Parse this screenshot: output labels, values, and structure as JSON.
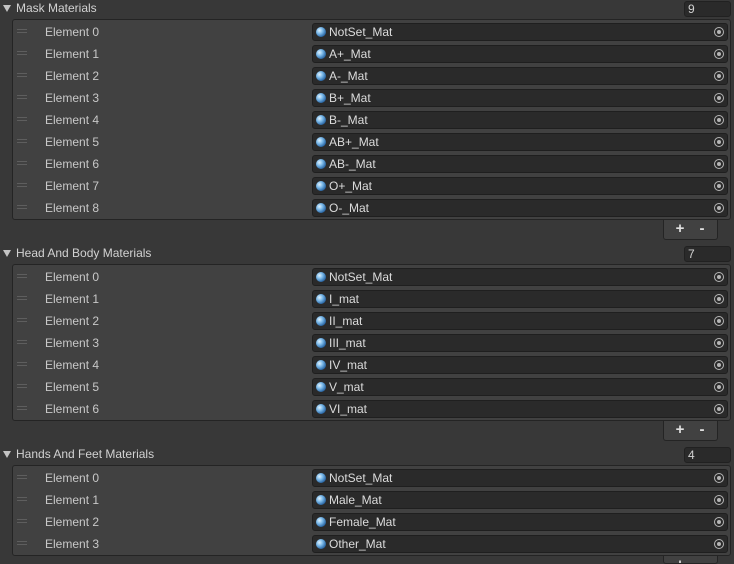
{
  "sections": [
    {
      "title": "Mask Materials",
      "size": "9",
      "items": [
        {
          "label": "Element 0",
          "value": "NotSet_Mat"
        },
        {
          "label": "Element 1",
          "value": "A+_Mat"
        },
        {
          "label": "Element 2",
          "value": "A-_Mat"
        },
        {
          "label": "Element 3",
          "value": "B+_Mat"
        },
        {
          "label": "Element 4",
          "value": "B-_Mat"
        },
        {
          "label": "Element 5",
          "value": "AB+_Mat"
        },
        {
          "label": "Element 6",
          "value": "AB-_Mat"
        },
        {
          "label": "Element 7",
          "value": "O+_Mat"
        },
        {
          "label": "Element 8",
          "value": "O-_Mat"
        }
      ]
    },
    {
      "title": "Head And Body Materials",
      "size": "7",
      "items": [
        {
          "label": "Element 0",
          "value": "NotSet_Mat"
        },
        {
          "label": "Element 1",
          "value": "I_mat"
        },
        {
          "label": "Element 2",
          "value": "II_mat"
        },
        {
          "label": "Element 3",
          "value": "III_mat"
        },
        {
          "label": "Element 4",
          "value": "IV_mat"
        },
        {
          "label": "Element 5",
          "value": "V_mat"
        },
        {
          "label": "Element 6",
          "value": "VI_mat"
        }
      ]
    },
    {
      "title": "Hands And Feet Materials",
      "size": "4",
      "items": [
        {
          "label": "Element 0",
          "value": "NotSet_Mat"
        },
        {
          "label": "Element 1",
          "value": "Male_Mat"
        },
        {
          "label": "Element 2",
          "value": "Female_Mat"
        },
        {
          "label": "Element 3",
          "value": "Other_Mat"
        }
      ]
    }
  ],
  "controls": {
    "add_label": "+",
    "remove_label": "-"
  },
  "icons": {
    "foldout": "triangle-down-icon",
    "drag": "drag-handle-icon",
    "material": "material-sphere-icon",
    "picker": "object-picker-icon"
  },
  "colors": {
    "background": "#383838",
    "list_bg": "#414141",
    "field_bg": "#2a2a2a",
    "text": "#d2d2d2"
  }
}
